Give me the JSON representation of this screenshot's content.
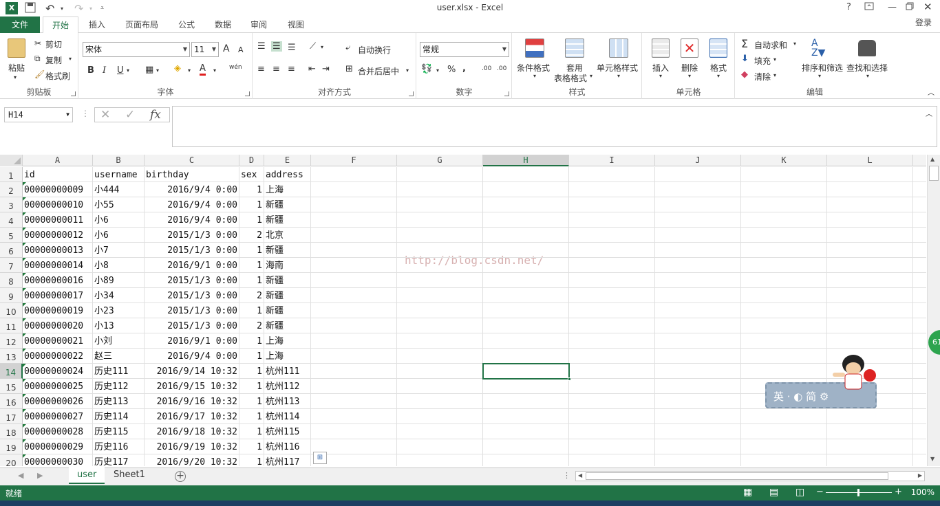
{
  "window": {
    "title": "user.xlsx - Excel",
    "app_icon": "X",
    "help": "?",
    "login": "登录"
  },
  "ribbon_tabs": [
    "文件",
    "开始",
    "插入",
    "页面布局",
    "公式",
    "数据",
    "审阅",
    "视图"
  ],
  "active_tab": "开始",
  "ribbon": {
    "clipboard": {
      "label": "剪贴板",
      "paste": "粘贴",
      "cut": "剪切",
      "copy": "复制",
      "format_painter": "格式刷"
    },
    "font": {
      "label": "字体",
      "font_name": "宋体",
      "font_size": "11",
      "bold": "B",
      "italic": "I",
      "underline": "U",
      "grow": "A",
      "shrink": "A",
      "phonetic": "wén"
    },
    "alignment": {
      "label": "对齐方式",
      "wrap": "自动换行",
      "merge": "合并后居中"
    },
    "number": {
      "label": "数字",
      "format": "常规",
      "percent": "%",
      "comma": ",",
      "inc_decimal": ".00",
      "dec_decimal": ".00"
    },
    "styles": {
      "label": "样式",
      "conditional": "条件格式",
      "table_format_1": "套用",
      "table_format_2": "表格格式",
      "cell_styles": "单元格样式"
    },
    "cells": {
      "label": "单元格",
      "insert": "插入",
      "delete": "删除",
      "format": "格式"
    },
    "editing": {
      "label": "编辑",
      "autosum": "自动求和",
      "fill": "填充",
      "clear": "清除",
      "sort_filter": "排序和筛选",
      "find_select": "查找和选择"
    }
  },
  "formula_bar": {
    "name_box": "H14",
    "fx": "fx",
    "content": ""
  },
  "columns": [
    "A",
    "B",
    "C",
    "D",
    "E",
    "F",
    "G",
    "H",
    "I",
    "J",
    "K",
    "L"
  ],
  "active_column": "H",
  "active_row": "14",
  "rows": [
    {
      "n": "1",
      "A": "id",
      "B": "username",
      "C": "birthday",
      "D": "sex",
      "E": "address"
    },
    {
      "n": "2",
      "A": "00000000009",
      "B": "小444",
      "C": "2016/9/4 0:00",
      "D": "1",
      "E": "上海"
    },
    {
      "n": "3",
      "A": "00000000010",
      "B": "小55",
      "C": "2016/9/4 0:00",
      "D": "1",
      "E": "新疆"
    },
    {
      "n": "4",
      "A": "00000000011",
      "B": "小6",
      "C": "2016/9/4 0:00",
      "D": "1",
      "E": "新疆"
    },
    {
      "n": "5",
      "A": "00000000012",
      "B": "小6",
      "C": "2015/1/3 0:00",
      "D": "2",
      "E": "北京"
    },
    {
      "n": "6",
      "A": "00000000013",
      "B": "小7",
      "C": "2015/1/3 0:00",
      "D": "1",
      "E": "新疆"
    },
    {
      "n": "7",
      "A": "00000000014",
      "B": "小8",
      "C": "2016/9/1 0:00",
      "D": "1",
      "E": "海南"
    },
    {
      "n": "8",
      "A": "00000000016",
      "B": "小89",
      "C": "2015/1/3 0:00",
      "D": "1",
      "E": "新疆"
    },
    {
      "n": "9",
      "A": "00000000017",
      "B": "小34",
      "C": "2015/1/3 0:00",
      "D": "2",
      "E": "新疆"
    },
    {
      "n": "10",
      "A": "00000000019",
      "B": "小23",
      "C": "2015/1/3 0:00",
      "D": "1",
      "E": "新疆"
    },
    {
      "n": "11",
      "A": "00000000020",
      "B": "小13",
      "C": "2015/1/3 0:00",
      "D": "2",
      "E": "新疆"
    },
    {
      "n": "12",
      "A": "00000000021",
      "B": "小刘",
      "C": "2016/9/1 0:00",
      "D": "1",
      "E": "上海"
    },
    {
      "n": "13",
      "A": "00000000022",
      "B": "赵三",
      "C": "2016/9/4 0:00",
      "D": "1",
      "E": "上海"
    },
    {
      "n": "14",
      "A": "00000000024",
      "B": "历史111",
      "C": "2016/9/14 10:32",
      "D": "1",
      "E": "杭州111"
    },
    {
      "n": "15",
      "A": "00000000025",
      "B": "历史112",
      "C": "2016/9/15 10:32",
      "D": "1",
      "E": "杭州112"
    },
    {
      "n": "16",
      "A": "00000000026",
      "B": "历史113",
      "C": "2016/9/16 10:32",
      "D": "1",
      "E": "杭州113"
    },
    {
      "n": "17",
      "A": "00000000027",
      "B": "历史114",
      "C": "2016/9/17 10:32",
      "D": "1",
      "E": "杭州114"
    },
    {
      "n": "18",
      "A": "00000000028",
      "B": "历史115",
      "C": "2016/9/18 10:32",
      "D": "1",
      "E": "杭州115"
    },
    {
      "n": "19",
      "A": "00000000029",
      "B": "历史116",
      "C": "2016/9/19 10:32",
      "D": "1",
      "E": "杭州116"
    },
    {
      "n": "20",
      "A": "00000000030",
      "B": "历史117",
      "C": "2016/9/20 10:32",
      "D": "1",
      "E": "杭州117"
    }
  ],
  "watermark": "http://blog.csdn.net/",
  "sheets": [
    "user",
    "Sheet1"
  ],
  "active_sheet": "user",
  "status": {
    "ready": "就绪",
    "zoom": "100%"
  },
  "ime": {
    "text": "英 · ◐ 简 ⚙"
  },
  "badge": "61",
  "colors": {
    "excel_green": "#217346",
    "header_bg": "#f3f3f3",
    "selected_header": "#d2d2d2"
  }
}
